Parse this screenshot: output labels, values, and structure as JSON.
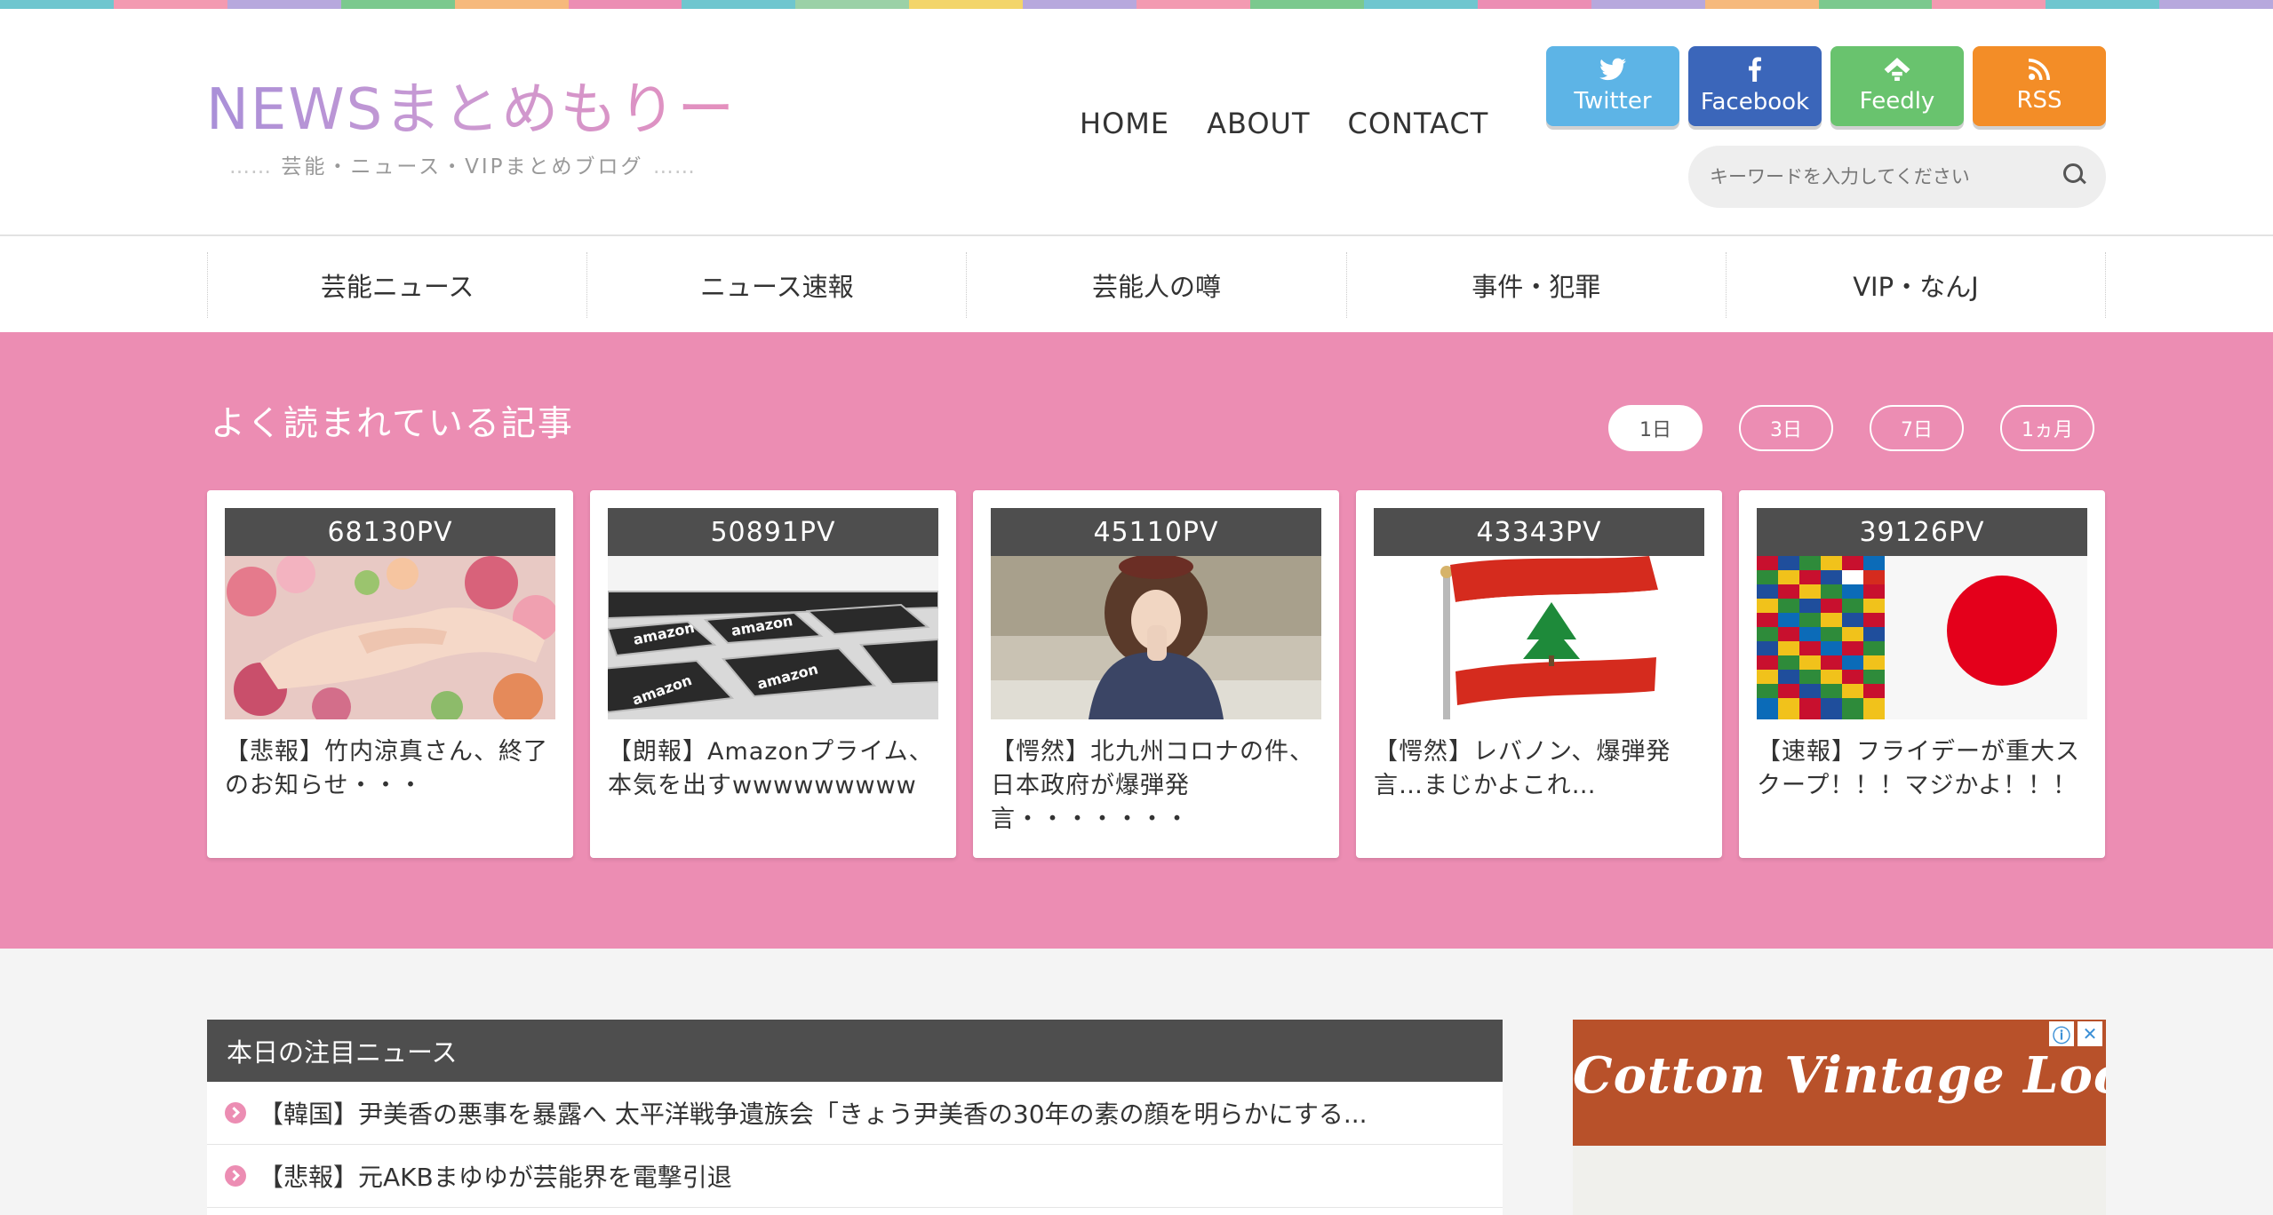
{
  "site": {
    "logo": "NEWSまとめもりー",
    "tagline": "芸能・ニュース・VIPまとめブログ",
    "tagline_dots": "……",
    "stripe_colors": [
      "#6fc6cf",
      "#f39ab1",
      "#b7a8dd",
      "#7bc98e",
      "#f6b97c",
      "#ec8db3",
      "#6fc6cf",
      "#9bd1a7",
      "#f3d56a",
      "#b7a8dd",
      "#f39ab1",
      "#7bc98e",
      "#6fc6cf",
      "#ec8db3",
      "#b7a8dd",
      "#f6b97c",
      "#7bc98e",
      "#f39ab1",
      "#6fc6cf",
      "#b7a8dd"
    ]
  },
  "topnav": [
    "HOME",
    "ABOUT",
    "CONTACT"
  ],
  "social": [
    {
      "label": "Twitter",
      "icon": "twitter-icon",
      "glyph": "🐦",
      "color": "#5db4e6"
    },
    {
      "label": "Facebook",
      "icon": "facebook-icon",
      "glyph": "f",
      "color": "#3b66ba"
    },
    {
      "label": "Feedly",
      "icon": "feedly-icon",
      "glyph": "◆",
      "color": "#69c36e"
    },
    {
      "label": "RSS",
      "icon": "rss-icon",
      "glyph": "◔",
      "color": "#f38d27"
    }
  ],
  "search": {
    "placeholder": "キーワードを入力してください"
  },
  "categories": [
    "芸能ニュース",
    "ニュース速報",
    "芸能人の噂",
    "事件・犯罪",
    "VIP・なんJ"
  ],
  "popular": {
    "title": "よく読まれている記事",
    "periods": [
      "1日",
      "3日",
      "7日",
      "1ヵ月"
    ],
    "active_period": "1日",
    "cards": [
      {
        "pv": "68130PV",
        "title": "【悲報】竹内涼真さん、終了のお知らせ・・・",
        "image": "holding-hands-flowers"
      },
      {
        "pv": "50891PV",
        "title": "【朗報】Amazonプライム、本気を出すwwwwwwwww",
        "image": "amazon-keyboard"
      },
      {
        "pv": "45110PV",
        "title": "【愕然】北九州コロナの件、日本政府が爆弾発言・・・・・・・",
        "image": "woman-portrait"
      },
      {
        "pv": "43343PV",
        "title": "【愕然】レバノン、爆弾発言…まじかよこれ…",
        "image": "lebanon-flag"
      },
      {
        "pv": "39126PV",
        "title": "【速報】フライデーが重大スクープ！！！マジかよ！！！",
        "image": "japan-flag"
      }
    ]
  },
  "news": {
    "heading": "本日の注目ニュース",
    "items": [
      "【韓国】尹美香の悪事を暴露へ 太平洋戦争遺族会「きょう尹美香の30年の素の顔を明らかにする...",
      "【悲報】元AKBまゆゆが芸能界を電撃引退"
    ]
  },
  "ad": {
    "text": "Cotton Vintage Looks",
    "badge_info": "ⓘ",
    "badge_close": "✕"
  }
}
